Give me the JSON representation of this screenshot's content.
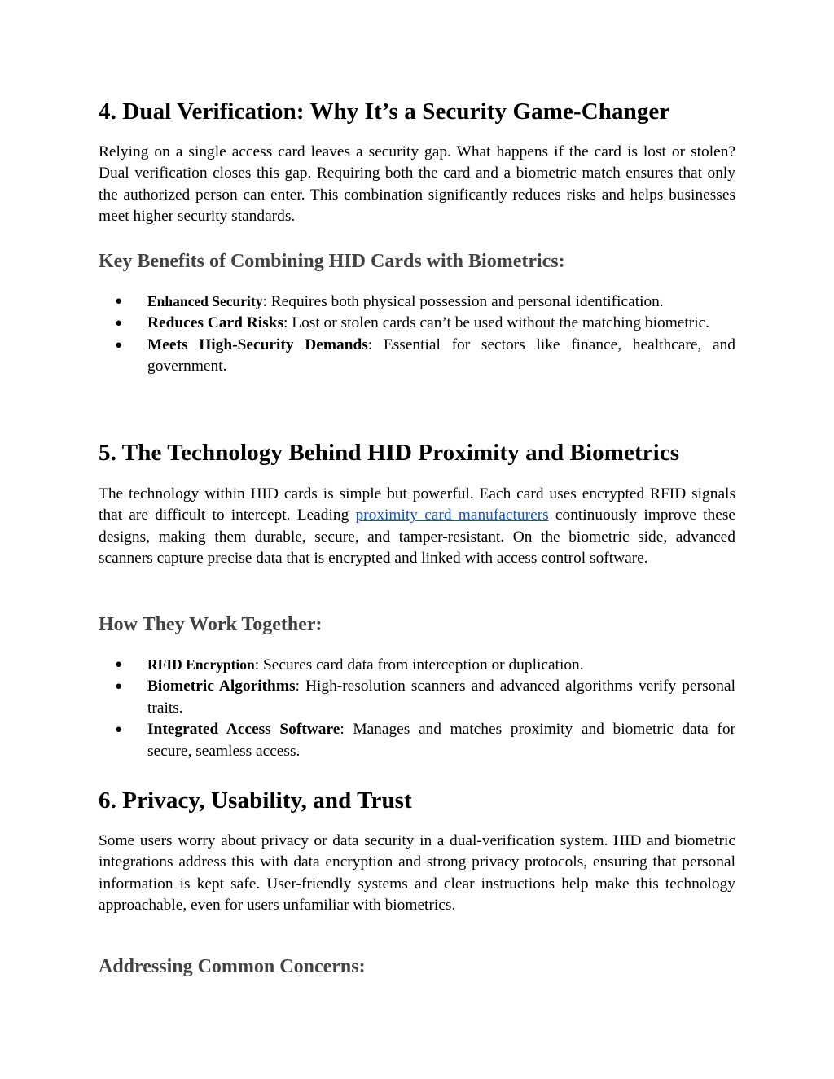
{
  "sections": [
    {
      "title": "4. Dual Verification: Why It’s a Security Game-Changer",
      "paragraph": "Relying on a single access card leaves a security gap. What happens if the card is lost or stolen? Dual verification closes this gap. Requiring both the card and a biometric match ensures that only the authorized person can enter. This combination significantly reduces risks and helps businesses meet higher security standards.",
      "subheading": "Key Benefits of Combining HID Cards with Biometrics:",
      "bullets": [
        {
          "term": "Enhanced Security",
          "text": ": Requires both physical possession and personal identification."
        },
        {
          "term": "Reduces Card Risks",
          "text": ": Lost or stolen cards can’t be used without the matching biometric."
        },
        {
          "term": "Meets High-Security Demands",
          "text": ": Essential for sectors like finance, healthcare, and government."
        }
      ]
    },
    {
      "title": "5. The Technology Behind HID Proximity and Biometrics",
      "paragraph_before_link": "The technology within HID cards is simple but powerful. Each card uses encrypted RFID signals that are difficult to intercept. Leading ",
      "link_text": "proximity card manufacturers",
      "link_color": "#1155cc",
      "paragraph_after_link": " continuously improve these designs, making them durable, secure, and tamper-resistant. On the biometric side, advanced scanners capture precise data that is encrypted and linked with access control software.",
      "subheading": "How They Work Together:",
      "bullets": [
        {
          "term": "RFID Encryption",
          "text": ": Secures card data from interception or duplication."
        },
        {
          "term": "Biometric Algorithms",
          "text": ": High-resolution scanners and advanced algorithms verify personal traits."
        },
        {
          "term": "Integrated Access Software",
          "text": ": Manages and matches proximity and biometric data for secure, seamless access."
        }
      ]
    },
    {
      "title": "6. Privacy, Usability, and Trust",
      "paragraph": "Some users worry about privacy or data security in a dual-verification system. HID and biometric integrations address this with data encryption and strong privacy protocols, ensuring that personal information is kept safe. User-friendly systems and clear instructions help make this technology approachable, even for users unfamiliar with biometrics.",
      "subheading": "Addressing Common Concerns:"
    }
  ],
  "bullet_glyph": "●",
  "colors": {
    "text": "#000000",
    "subheading": "#434343",
    "link": "#1155cc"
  }
}
